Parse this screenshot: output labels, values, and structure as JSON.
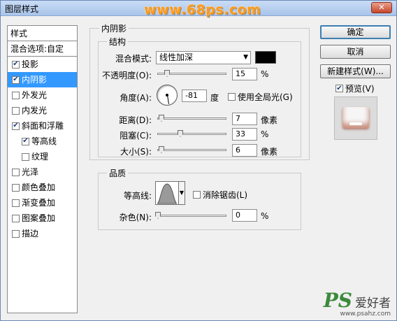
{
  "window": {
    "title": "图层样式",
    "watermark": "www.68ps.com",
    "close_label": "✕"
  },
  "style_list": {
    "header": "样式",
    "blend_options": "混合选项:自定",
    "items": [
      {
        "label": "投影",
        "checked": true,
        "selected": false,
        "indent": false
      },
      {
        "label": "内阴影",
        "checked": true,
        "selected": true,
        "indent": false
      },
      {
        "label": "外发光",
        "checked": false,
        "selected": false,
        "indent": false
      },
      {
        "label": "内发光",
        "checked": false,
        "selected": false,
        "indent": false
      },
      {
        "label": "斜面和浮雕",
        "checked": true,
        "selected": false,
        "indent": false
      },
      {
        "label": "等高线",
        "checked": true,
        "selected": false,
        "indent": true
      },
      {
        "label": "纹理",
        "checked": false,
        "selected": false,
        "indent": true
      },
      {
        "label": "光泽",
        "checked": false,
        "selected": false,
        "indent": false
      },
      {
        "label": "颜色叠加",
        "checked": false,
        "selected": false,
        "indent": false
      },
      {
        "label": "渐变叠加",
        "checked": false,
        "selected": false,
        "indent": false
      },
      {
        "label": "图案叠加",
        "checked": false,
        "selected": false,
        "indent": false
      },
      {
        "label": "描边",
        "checked": false,
        "selected": false,
        "indent": false
      }
    ]
  },
  "buttons": {
    "ok": "确定",
    "cancel": "取消",
    "new_style": "新建样式(W)...",
    "preview": "预览(V)"
  },
  "panel": {
    "title": "内阴影",
    "structure": {
      "label": "结构",
      "blend_mode_label": "混合模式:",
      "blend_mode_value": "线性加深",
      "blend_color": "#000000",
      "opacity_label": "不透明度(O):",
      "opacity_value": "15",
      "opacity_unit": "%",
      "angle_label": "角度(A):",
      "angle_value": "-81",
      "angle_unit": "度",
      "global_light_label": "使用全局光(G)",
      "distance_label": "距离(D):",
      "distance_value": "7",
      "distance_unit": "像素",
      "choke_label": "阻塞(C):",
      "choke_value": "33",
      "choke_unit": "%",
      "size_label": "大小(S):",
      "size_value": "6",
      "size_unit": "像素"
    },
    "quality": {
      "label": "品质",
      "contour_label": "等高线:",
      "anti_alias_label": "消除锯齿(L)",
      "noise_label": "杂色(N):",
      "noise_value": "0",
      "noise_unit": "%"
    }
  },
  "logo": {
    "ps": "PS",
    "cn": "爱好者",
    "url": "www.psahz.com"
  }
}
